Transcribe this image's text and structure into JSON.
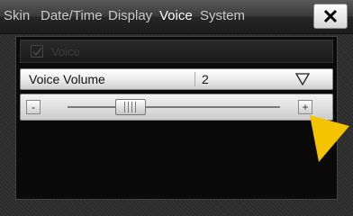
{
  "tabs": [
    {
      "label": "Skin"
    },
    {
      "label": "Date/Time"
    },
    {
      "label": "Display"
    },
    {
      "label": "Voice"
    },
    {
      "label": "System"
    }
  ],
  "active_tab": "Voice",
  "close_icon": "close-x-icon",
  "voice_toggle": {
    "label": "Voice",
    "checked": true,
    "disabled": true
  },
  "volume": {
    "label": "Voice Volume",
    "value": "2",
    "icon": "triangle-down-icon"
  },
  "slider": {
    "minus_label": "-",
    "plus_label": "+",
    "level": 0.26
  },
  "colors": {
    "accent_yellow": "#f5c400",
    "panel_bg": "#0a0a0a",
    "tab_text": "#c9c9c9",
    "active_tab_text": "#ffffff"
  }
}
